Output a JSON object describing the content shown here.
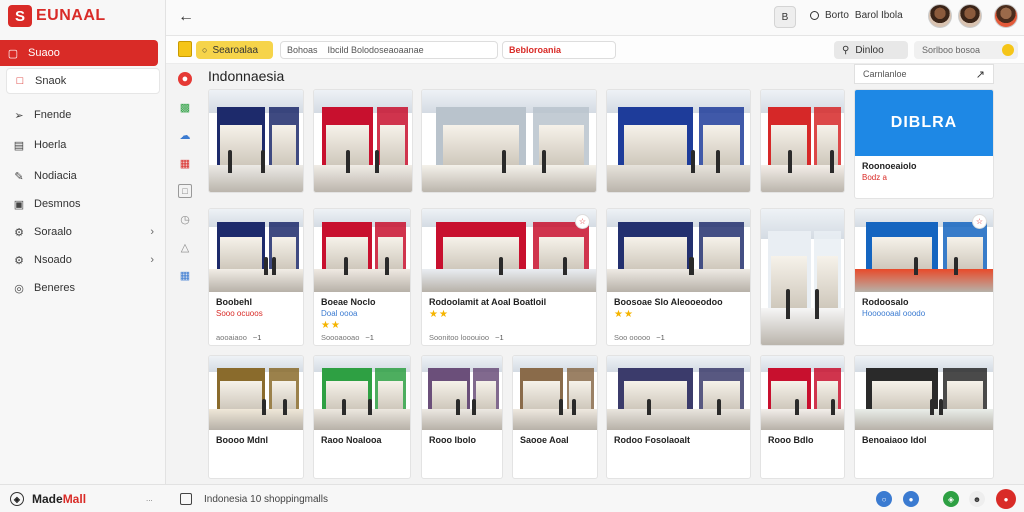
{
  "app": {
    "logo_letter": "S",
    "logo_text": "EUNAAL",
    "brand": [
      "Made",
      "Mall"
    ],
    "brand_sub": "...",
    "status": "Indonesia 10 shoppingmalls"
  },
  "sidebar": {
    "items": [
      {
        "label": "Suaoo",
        "icon": "bag-icon",
        "state": "active"
      },
      {
        "label": "Snaok",
        "icon": "square-icon",
        "state": "outlined"
      },
      {
        "label": "Fnende",
        "icon": "compass-icon"
      },
      {
        "label": "Hoerla",
        "icon": "document-icon"
      },
      {
        "label": "Nodiacia",
        "icon": "pen-icon"
      },
      {
        "label": "Desmnos",
        "icon": "monitor-icon"
      },
      {
        "label": "Soraalo",
        "icon": "settings-icon",
        "chevron": true
      },
      {
        "label": "Nsoado",
        "icon": "settings-icon",
        "chevron": true
      },
      {
        "label": "Beneres",
        "icon": "globe-icon"
      }
    ]
  },
  "topbar": {
    "user": [
      "Borto",
      "Barol Ibola"
    ],
    "small_btn": "B"
  },
  "filters": {
    "search_label": "Searoalaa",
    "field1": [
      "Bohoas",
      "Ibcild Bolodoseaoaanae"
    ],
    "field2": "Bebloroania",
    "sort_label": "Dinloo",
    "view_label": "Sorlboo bosoa"
  },
  "content": {
    "title": "Indonnaesia",
    "dropdown": "Carnlanloe"
  },
  "cards": [
    {
      "title": "",
      "sub": "",
      "meta": "",
      "stars": 0
    },
    {
      "title": "",
      "sub": "",
      "meta": "",
      "stars": 0
    },
    {
      "title": "",
      "sub": "",
      "meta": "",
      "stars": 0
    },
    {
      "title": "",
      "sub": "",
      "meta": "",
      "stars": 0
    },
    {
      "title": "",
      "sub": "",
      "meta": "",
      "stars": 0
    },
    {
      "title": "Roonoeaiolo",
      "sub": "Bodz a",
      "meta": "",
      "stars": 0,
      "logo": "DIBLRA"
    },
    {
      "title": "Boobehl",
      "sub": "Sooo ocuoos",
      "meta": "aooaiaoo",
      "tail": "~1",
      "stars": 0
    },
    {
      "title": "Boeae Noclo",
      "sub": "Doal oooa",
      "meta": "Soooaooao",
      "tail": "~1",
      "stars": 2,
      "subBlue": true
    },
    {
      "title": "Rodoolamit at Aoal Boatloil",
      "sub": "",
      "meta": "Soonitoo looouioo",
      "tail": "~1",
      "stars": 2
    },
    {
      "title": "Boosoae Slo Aleooeodoo",
      "sub": "",
      "meta": "Soo ooooo",
      "tail": "~1",
      "stars": 2
    },
    {
      "title": "",
      "sub": "",
      "meta": "",
      "stars": 0
    },
    {
      "title": "Rodoosalo",
      "sub": "Hoooooaal ooodo",
      "meta": "",
      "stars": 0,
      "subBlue": true
    },
    {
      "title": "Boooo Mdnl",
      "sub": "",
      "meta": "",
      "stars": 0
    },
    {
      "title": "Raoo Noalooa",
      "sub": "",
      "meta": "",
      "stars": 0
    },
    {
      "title": "Rooo Ibolo",
      "sub": "",
      "meta": "",
      "stars": 0
    },
    {
      "title": "Saooe Aoal",
      "sub": "",
      "meta": "",
      "stars": 0
    },
    {
      "title": "Rodoo Fosolaoalt",
      "sub": "",
      "meta": "",
      "stars": 0
    },
    {
      "title": "Rooo Bdlo",
      "sub": "",
      "meta": "",
      "stars": 0
    },
    {
      "title": "Benoaiaoo Idol",
      "sub": "",
      "meta": "",
      "stars": 0
    }
  ],
  "colors": {
    "brand_red": "#d92b27",
    "accent_yellow": "#f6d44a",
    "link_blue": "#3b7bd1"
  }
}
